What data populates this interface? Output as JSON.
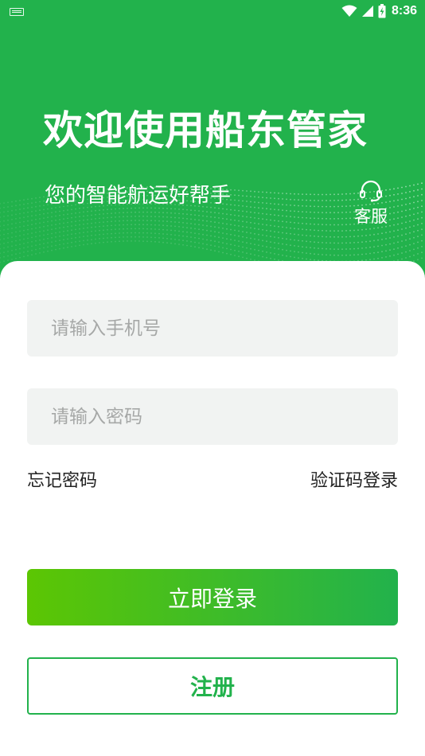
{
  "status_bar": {
    "time": "8:36",
    "icons": [
      "keyboard-icon",
      "wifi-icon",
      "signal-icon",
      "battery-charging-icon"
    ]
  },
  "hero": {
    "title": "欢迎使用船东管家",
    "subtitle": "您的智能航运好帮手",
    "service_label": "客服",
    "service_icon": "headset-icon",
    "background_color": "#22b24c"
  },
  "form": {
    "phone_placeholder": "请输入手机号",
    "phone_value": "",
    "password_placeholder": "请输入密码",
    "password_value": "",
    "forgot_password": "忘记密码",
    "sms_login": "验证码登录",
    "login_button": "立即登录",
    "register_button": "注册"
  },
  "colors": {
    "brand_green": "#22b24c",
    "gradient_start": "#5cc603",
    "field_background": "#f1f3f2",
    "placeholder_text": "#a6a8a7"
  }
}
